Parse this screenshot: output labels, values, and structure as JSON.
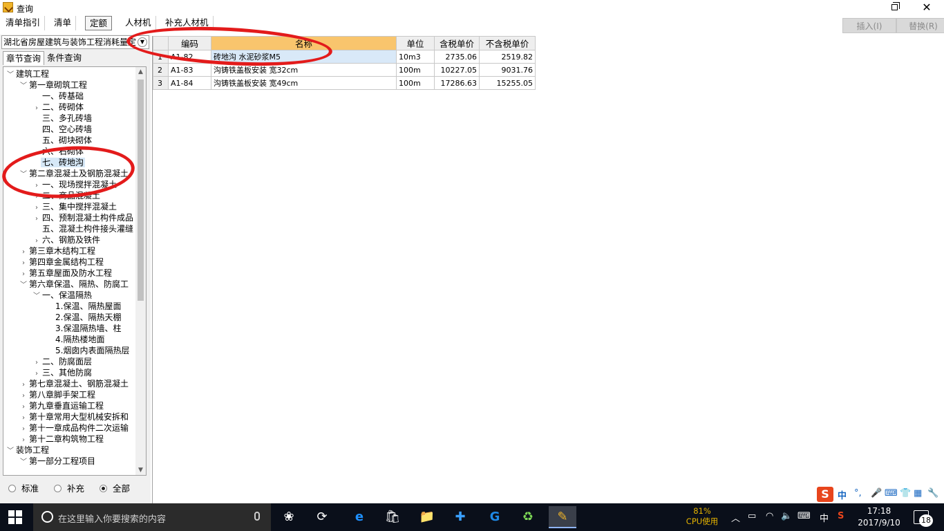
{
  "window": {
    "title": "查询",
    "restore_symbol": "❐",
    "close_symbol": "✕"
  },
  "toolbar": {
    "tabs": [
      "清单指引",
      "清单",
      "定额",
      "人材机",
      "补充人材机"
    ],
    "active_tab": "定额",
    "insert_label": "插入(I)",
    "replace_label": "替换(R)"
  },
  "left": {
    "library": "湖北省房屋建筑与装饰工程消耗量定",
    "subtabs": [
      "章节查询",
      "条件查询"
    ],
    "tree": [
      {
        "label": "建筑工程",
        "expander": "﹀"
      },
      {
        "label": "第一章砌筑工程",
        "expander": "﹀"
      },
      {
        "label": "一、砖基础",
        "expander": ""
      },
      {
        "label": "二、砖砌体",
        "expander": "›"
      },
      {
        "label": "三、多孔砖墙",
        "expander": ""
      },
      {
        "label": "四、空心砖墙",
        "expander": ""
      },
      {
        "label": "五、砌块砌体",
        "expander": ""
      },
      {
        "label": "六、石砌体",
        "expander": ""
      },
      {
        "label": "七、砖地沟",
        "expander": ""
      },
      {
        "label": "第二章混凝土及钢筋混凝土",
        "expander": "﹀"
      },
      {
        "label": "一、现场搅拌混凝土",
        "expander": "›"
      },
      {
        "label": "二、商品混凝土",
        "expander": "›"
      },
      {
        "label": "三、集中搅拌混凝土",
        "expander": "›"
      },
      {
        "label": "四、预制混凝土构件成品",
        "expander": "›"
      },
      {
        "label": "五、混凝土构件接头灌缝",
        "expander": ""
      },
      {
        "label": "六、钢筋及铁件",
        "expander": "›"
      },
      {
        "label": "第三章木结构工程",
        "expander": "›"
      },
      {
        "label": "第四章金属结构工程",
        "expander": "›"
      },
      {
        "label": "第五章屋面及防水工程",
        "expander": "›"
      },
      {
        "label": "第六章保温、隔热、防腐工",
        "expander": "﹀"
      },
      {
        "label": "一、保温隔热",
        "expander": "﹀"
      },
      {
        "label": "1.保温、隔热屋面",
        "expander": ""
      },
      {
        "label": "2.保温、隔热天棚",
        "expander": ""
      },
      {
        "label": "3.保温隔热墙、柱",
        "expander": ""
      },
      {
        "label": "4.隔热楼地面",
        "expander": ""
      },
      {
        "label": "5.烟囱内表面隔热层",
        "expander": ""
      },
      {
        "label": "二、防腐面层",
        "expander": "›"
      },
      {
        "label": "三、其他防腐",
        "expander": "›"
      },
      {
        "label": "第七章混凝土、钢筋混凝土",
        "expander": "›"
      },
      {
        "label": "第八章脚手架工程",
        "expander": "›"
      },
      {
        "label": "第九章垂直运输工程",
        "expander": "›"
      },
      {
        "label": "第十章常用大型机械安拆和",
        "expander": "›"
      },
      {
        "label": "第十一章成品构件二次运输",
        "expander": "›"
      },
      {
        "label": "第十二章构筑物工程",
        "expander": "›"
      },
      {
        "label": "装饰工程",
        "expander": "﹀"
      },
      {
        "label": "第一部分工程项目",
        "expander": "﹀"
      }
    ],
    "radios": [
      {
        "label": "标准",
        "checked": false
      },
      {
        "label": "补充",
        "checked": false
      },
      {
        "label": "全部",
        "checked": true
      }
    ]
  },
  "grid": {
    "headers": [
      "",
      "编码",
      "名称",
      "单位",
      "含税单价",
      "不含税单价"
    ],
    "rows": [
      {
        "n": "1",
        "code": "A1-82",
        "name": "砖地沟 水泥砂浆M5",
        "unit": "10m3",
        "tax": "2735.06",
        "notax": "2519.82"
      },
      {
        "n": "2",
        "code": "A1-83",
        "name": "沟铸铁盖板安装 宽32cm",
        "unit": "100m",
        "tax": "10227.05",
        "notax": "9031.76"
      },
      {
        "n": "3",
        "code": "A1-84",
        "name": "沟铸铁盖板安装 宽49cm",
        "unit": "100m",
        "tax": "17286.63",
        "notax": "15255.05"
      }
    ]
  },
  "ime": {
    "logo": "S",
    "mode": "中"
  },
  "taskbar": {
    "search_placeholder": "在这里输入你要搜索的内容",
    "cpu_percent": "81%",
    "cpu_label": "CPU使用",
    "lang": "中",
    "time": "17:18",
    "date": "2017/9/10",
    "notifications": "18"
  }
}
